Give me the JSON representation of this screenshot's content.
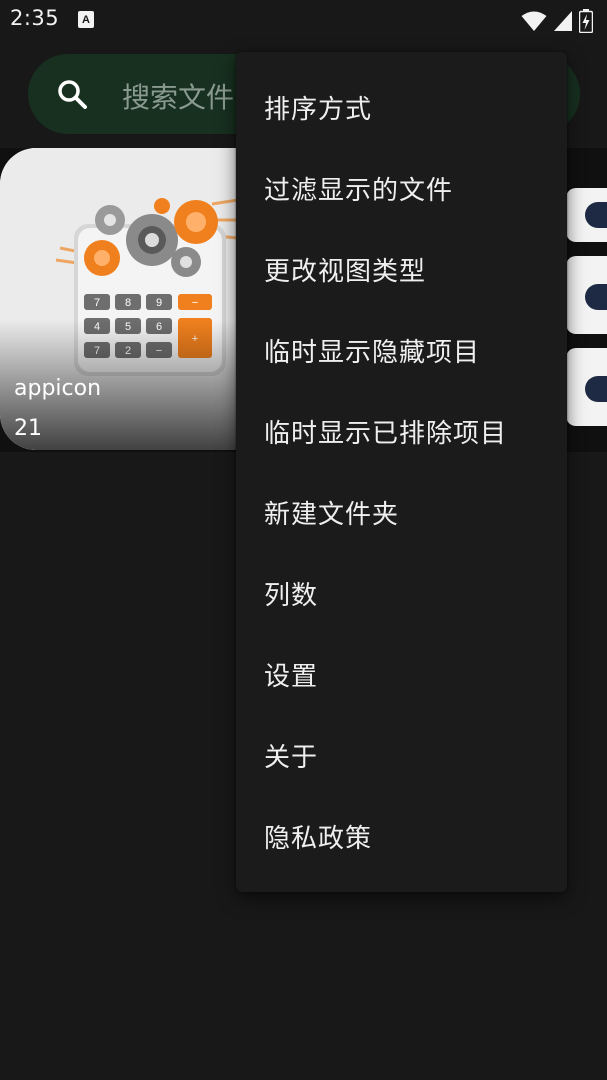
{
  "status_bar": {
    "time": "2:35",
    "app_icon_letter": "A"
  },
  "search": {
    "placeholder": "搜索文件"
  },
  "album": {
    "name": "appicon",
    "count": "21",
    "calc_keys": [
      "7",
      "8",
      "9",
      "−",
      "4",
      "5",
      "6",
      "+",
      "7",
      "2",
      "−"
    ]
  },
  "menu": {
    "items": [
      {
        "label": "排序方式"
      },
      {
        "label": "过滤显示的文件"
      },
      {
        "label": "更改视图类型"
      },
      {
        "label": "临时显示隐藏项目"
      },
      {
        "label": "临时显示已排除项目"
      },
      {
        "label": "新建文件夹"
      },
      {
        "label": "列数"
      },
      {
        "label": "设置"
      },
      {
        "label": "关于"
      },
      {
        "label": "隐私政策"
      }
    ]
  },
  "colors": {
    "background": "#181818",
    "search_bg": "#17301f",
    "menu_bg": "#1b1b1b",
    "accent_orange": "#f0801e"
  },
  "icons": [
    "search-icon",
    "wifi-icon",
    "signal-icon",
    "battery-icon",
    "app-notification-icon"
  ]
}
